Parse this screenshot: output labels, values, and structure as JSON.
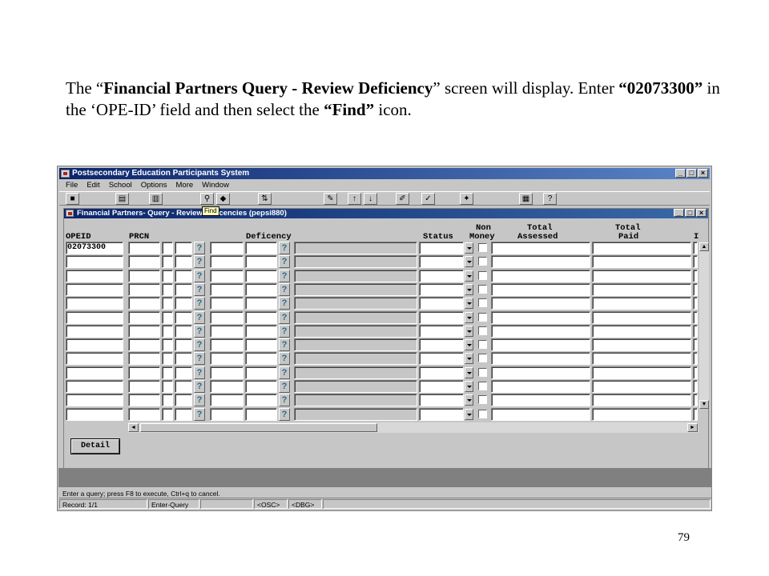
{
  "caption": {
    "parts": [
      {
        "text": "The “",
        "bold": false
      },
      {
        "text": "Financial Partners Query - Review Deficiency",
        "bold": true
      },
      {
        "text": "” screen will display.  Enter ",
        "bold": false
      },
      {
        "text": "“02073300”",
        "bold": true
      },
      {
        "text": " in the ‘OPE-ID’  field and then select the ",
        "bold": false
      },
      {
        "text": "“Find”",
        "bold": true
      },
      {
        "text": " icon.",
        "bold": false
      }
    ]
  },
  "page_number": "79",
  "app": {
    "title": "Postsecondary Education Participants System",
    "window_buttons": {
      "minimize": "_",
      "maximize": "□",
      "close": "×"
    },
    "menu": [
      "File",
      "Edit",
      "School",
      "Options",
      "More",
      "Window"
    ],
    "toolbar": [
      {
        "icon": "exit-icon",
        "glyph": "■"
      },
      {
        "icon": "print-icon",
        "glyph": "▤"
      },
      {
        "icon": "save-icon",
        "glyph": "▥"
      },
      {
        "icon": "find-icon",
        "glyph": "⚲"
      },
      {
        "icon": "execute-query-icon",
        "glyph": "◆"
      },
      {
        "icon": "enter-query-icon",
        "glyph": "⇅"
      },
      {
        "icon": "clear-icon",
        "glyph": "✎"
      },
      {
        "icon": "previous-record-icon",
        "glyph": "↑"
      },
      {
        "icon": "next-record-icon",
        "glyph": "↓"
      },
      {
        "icon": "edit-icon",
        "glyph": "✐"
      },
      {
        "icon": "list-icon",
        "glyph": "✓"
      },
      {
        "icon": "spellcheck-icon",
        "glyph": "✦"
      },
      {
        "icon": "calculator-icon",
        "glyph": "▦"
      },
      {
        "icon": "help-icon",
        "glyph": "?"
      }
    ],
    "find_tooltip": "Find",
    "status_message": "Enter a query;  press F8 to execute, Ctrl+q  to cancel.",
    "status_line": [
      "Record: 1/1",
      "Enter-Query",
      "",
      "<OSC>",
      "<DBG>"
    ]
  },
  "form": {
    "title": "Financial Partners- Query - Review Deficencies (pepsi880)",
    "headers": {
      "opeid": "OPEID",
      "prcn": "PRCN",
      "deficency": "Deficency",
      "status": "Status",
      "non_money_1": "Non",
      "non_money_2": "Money",
      "total_assessed_1": "Total",
      "total_assessed_2": "Assessed",
      "total_paid_1": "Total",
      "total_paid_2": "Paid",
      "cut": "I"
    },
    "lov_glyph": "?",
    "rows": [
      {
        "opeid": "02073300"
      },
      {
        "opeid": ""
      },
      {
        "opeid": ""
      },
      {
        "opeid": ""
      },
      {
        "opeid": ""
      },
      {
        "opeid": ""
      },
      {
        "opeid": ""
      },
      {
        "opeid": ""
      },
      {
        "opeid": ""
      },
      {
        "opeid": ""
      },
      {
        "opeid": ""
      },
      {
        "opeid": ""
      },
      {
        "opeid": ""
      }
    ],
    "detail_button": "Detail",
    "scroll_up": "▲",
    "scroll_down": "▼",
    "scroll_left": "◄",
    "scroll_right": "►"
  }
}
